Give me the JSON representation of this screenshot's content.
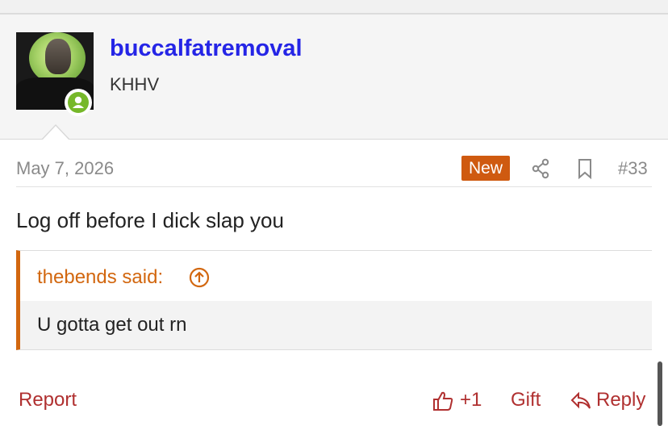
{
  "user": {
    "username": "buccalfatremoval",
    "title": "KHHV"
  },
  "post": {
    "date": "May 7, 2026",
    "new_badge": "New",
    "number": "#33",
    "message": "Log off before I dick slap you"
  },
  "quote": {
    "author": "thebends said:",
    "text": "U gotta get out rn"
  },
  "actions": {
    "report": "Report",
    "like_count": "+1",
    "gift": "Gift",
    "reply": "Reply"
  },
  "colors": {
    "username": "#2525e6",
    "accent_orange": "#d2670f",
    "action_red": "#b03030",
    "online_green": "#76b82a"
  },
  "icons": [
    "online-status-icon",
    "share-icon",
    "bookmark-icon",
    "quote-up-icon",
    "like-icon",
    "reply-icon"
  ]
}
